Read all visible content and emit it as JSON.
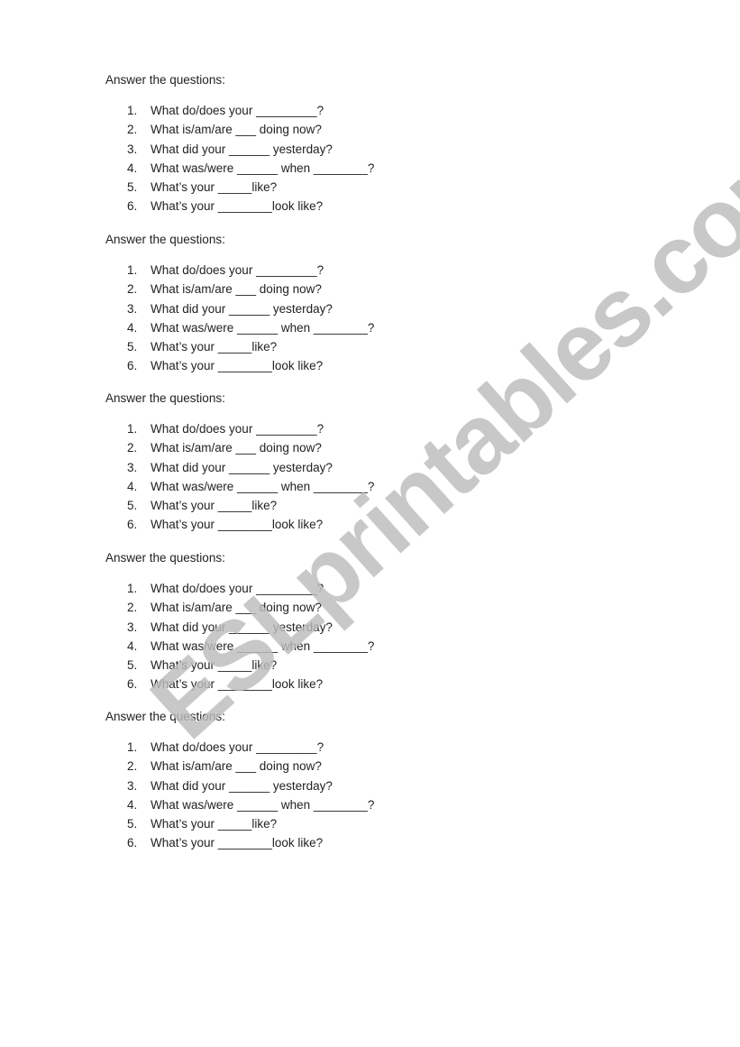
{
  "worksheet": {
    "sections": [
      {
        "heading": "Answer the questions:",
        "questions": [
          {
            "num": "1.",
            "text": "What do/does your _________?"
          },
          {
            "num": "2.",
            "text": "What is/am/are ___ doing now?"
          },
          {
            "num": "3.",
            "text": "What did your ______ yesterday?"
          },
          {
            "num": "4.",
            "text": "What was/were ______ when ________?"
          },
          {
            "num": "5.",
            "text": "What’s your _____like?"
          },
          {
            "num": "6.",
            "text": "What’s your ________look like?"
          }
        ]
      },
      {
        "heading": "Answer the questions:",
        "questions": [
          {
            "num": "1.",
            "text": "What do/does your _________?"
          },
          {
            "num": "2.",
            "text": "What is/am/are ___ doing now?"
          },
          {
            "num": "3.",
            "text": "What did your ______ yesterday?"
          },
          {
            "num": "4.",
            "text": "What was/were ______ when ________?"
          },
          {
            "num": "5.",
            "text": "What’s your _____like?"
          },
          {
            "num": "6.",
            "text": "What’s your ________look like?"
          }
        ]
      },
      {
        "heading": "Answer the questions:",
        "questions": [
          {
            "num": "1.",
            "text": "What do/does your _________?"
          },
          {
            "num": "2.",
            "text": "What is/am/are ___ doing now?"
          },
          {
            "num": "3.",
            "text": "What did your ______ yesterday?"
          },
          {
            "num": "4.",
            "text": "What was/were ______ when ________?"
          },
          {
            "num": "5.",
            "text": "What’s your _____like?"
          },
          {
            "num": "6.",
            "text": "What’s your ________look like?"
          }
        ]
      },
      {
        "heading": "Answer the questions:",
        "questions": [
          {
            "num": "1.",
            "text": "What do/does your _________?"
          },
          {
            "num": "2.",
            "text": "What is/am/are ___ doing now?"
          },
          {
            "num": "3.",
            "text": "What did your ______ yesterday?"
          },
          {
            "num": "4.",
            "text": "What was/were ______ when ________?"
          },
          {
            "num": "5.",
            "text": "What’s your _____like?"
          },
          {
            "num": "6.",
            "text": "What’s your ________look like?"
          }
        ]
      },
      {
        "heading": "Answer the questions:",
        "questions": [
          {
            "num": "1.",
            "text": "What do/does your _________?"
          },
          {
            "num": "2.",
            "text": "What is/am/are ___ doing now?"
          },
          {
            "num": "3.",
            "text": "What did your ______ yesterday?"
          },
          {
            "num": "4.",
            "text": "What was/were ______ when ________?"
          },
          {
            "num": "5.",
            "text": "What’s your _____like?"
          },
          {
            "num": "6.",
            "text": "What’s your ________look like?"
          }
        ]
      }
    ]
  },
  "watermark": {
    "text": "ESLprintables.com",
    "color": "#bdbdbd"
  }
}
